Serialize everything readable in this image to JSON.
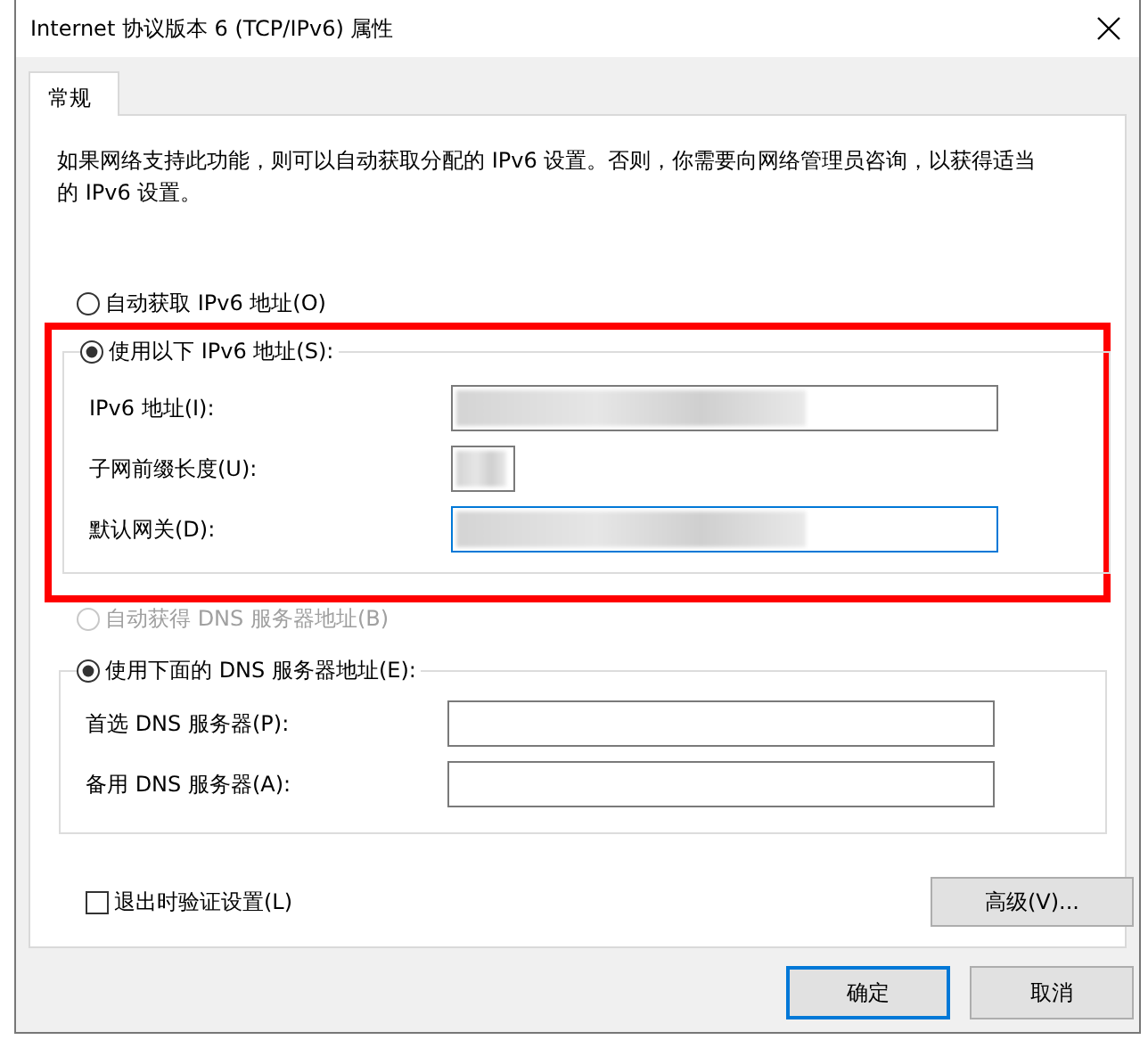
{
  "window": {
    "title": "Internet 协议版本 6 (TCP/IPv6) 属性"
  },
  "tabs": [
    {
      "label": "常规",
      "selected": true
    }
  ],
  "description": "如果网络支持此功能，则可以自动获取分配的 IPv6 设置。否则，你需要向网络管理员咨询，以获得适当的 IPv6 设置。",
  "ip_options": [
    {
      "label": "自动获取 IPv6 地址(O)",
      "selected": false,
      "disabled": false
    },
    {
      "label": "使用以下 IPv6 地址(S):",
      "selected": true,
      "disabled": false
    }
  ],
  "ip_fields": [
    {
      "label": "IPv6 地址(I):",
      "kind": "wide",
      "redacted": true,
      "focused": false
    },
    {
      "label": "子网前缀长度(U):",
      "kind": "narrow",
      "redacted": true,
      "focused": false
    },
    {
      "label": "默认网关(D):",
      "kind": "wide",
      "redacted": true,
      "focused": true
    }
  ],
  "dns_options": [
    {
      "label": "自动获得 DNS 服务器地址(B)",
      "selected": false,
      "disabled": true
    },
    {
      "label": "使用下面的 DNS 服务器地址(E):",
      "selected": true,
      "disabled": false
    }
  ],
  "dns_fields": [
    {
      "label": "首选 DNS 服务器(P):",
      "kind": "wide",
      "focused": false
    },
    {
      "label": "备用 DNS 服务器(A):",
      "kind": "wide",
      "focused": false
    }
  ],
  "validate_checkbox": {
    "label": "退出时验证设置(L)",
    "checked": false
  },
  "advanced_button": "高级(V)...",
  "buttons": [
    {
      "label": "确定",
      "default": true
    },
    {
      "label": "取消",
      "default": false
    }
  ]
}
